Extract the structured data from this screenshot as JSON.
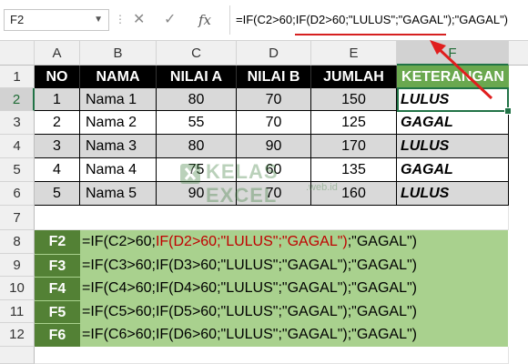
{
  "name_box": "F2",
  "formula": {
    "prefix": "=IF(C2>60;",
    "nested": "IF(D2>60;\"LULUS\";\"GAGAL\")",
    "suffix": ";\"GAGAL\")"
  },
  "icons": {
    "cancel": "close-icon",
    "enter": "check-icon",
    "insert_function": "fx-icon"
  },
  "columns": [
    "A",
    "B",
    "C",
    "D",
    "E",
    "F"
  ],
  "rows": [
    "1",
    "2",
    "3",
    "4",
    "5",
    "6",
    "7",
    "8",
    "9",
    "10",
    "11",
    "12"
  ],
  "table": {
    "headers": [
      "NO",
      "NAMA",
      "NILAI A",
      "NILAI B",
      "JUMLAH",
      "KETERANGAN"
    ],
    "rows": [
      [
        "1",
        "Nama 1",
        "80",
        "70",
        "150",
        "LULUS"
      ],
      [
        "2",
        "Nama 2",
        "55",
        "70",
        "125",
        "GAGAL"
      ],
      [
        "3",
        "Nama 3",
        "80",
        "90",
        "170",
        "LULUS"
      ],
      [
        "4",
        "Nama 4",
        "75",
        "60",
        "135",
        "GAGAL"
      ],
      [
        "5",
        "Nama 5",
        "90",
        "70",
        "160",
        "LULUS"
      ]
    ]
  },
  "formulas_list": [
    {
      "label": "F2",
      "pre": "=IF(C2>60;",
      "mid": "IF(D2>60;\"LULUS\";\"GAGAL\")",
      "post": ";\"GAGAL\")"
    },
    {
      "label": "F3",
      "pre": "=IF(C3>60;",
      "mid": "IF(D3>60;\"LULUS\";\"GAGAL\")",
      "post": ";\"GAGAL\")"
    },
    {
      "label": "F4",
      "pre": "=IF(C4>60;",
      "mid": "IF(D4>60;\"LULUS\";\"GAGAL\")",
      "post": ";\"GAGAL\")"
    },
    {
      "label": "F5",
      "pre": "=IF(C5>60;",
      "mid": "IF(D5>60;\"LULUS\";\"GAGAL\")",
      "post": ";\"GAGAL\")"
    },
    {
      "label": "F6",
      "pre": "=IF(C6>60;",
      "mid": "IF(D6>60;\"LULUS\";\"GAGAL\")",
      "post": ";\"GAGAL\")"
    }
  ],
  "watermark": {
    "brand": "KELAS EXCEL",
    "sub": ".web.id"
  },
  "colors": {
    "header_bg": "#000000",
    "ket_header": "#6aa84f",
    "formula_panel": "#a9d18e",
    "formula_label": "#538135",
    "highlight": "#c00000"
  }
}
